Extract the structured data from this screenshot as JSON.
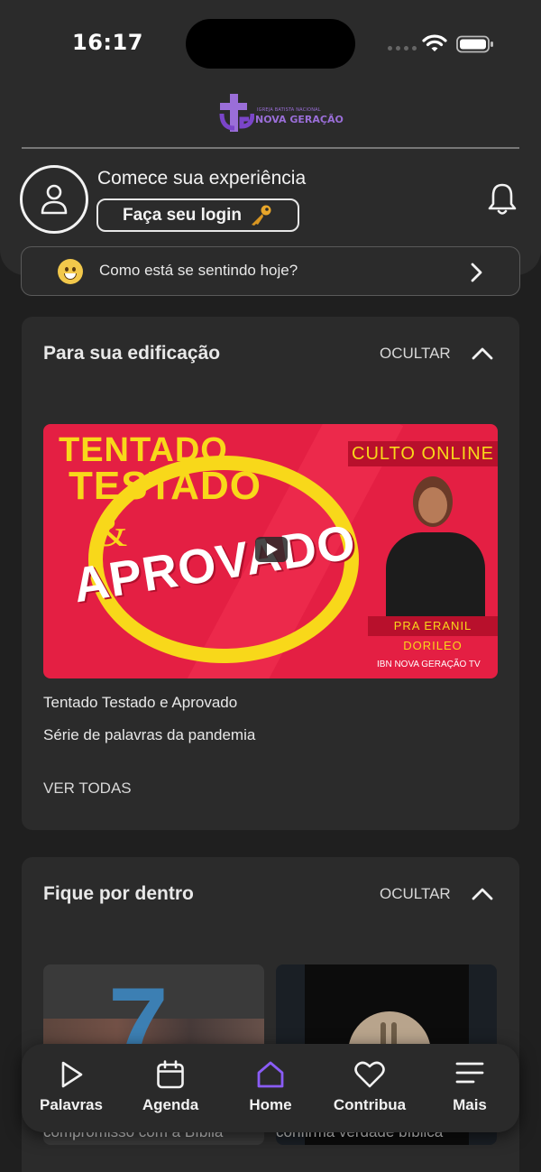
{
  "status": {
    "time": "16:17"
  },
  "logo": {
    "small_text": "IGREJA BATISTA NACIONAL",
    "big_text": "NOVA GERAÇÃO"
  },
  "header": {
    "welcome_title": "Comece sua experiência",
    "login_label": "Faça seu login"
  },
  "feeling": {
    "prompt": "Como está se sentindo hoje?"
  },
  "section_edification": {
    "title": "Para sua edificação",
    "hide_label": "OCULTAR",
    "thumbnail": {
      "line1": "TENTADO",
      "line2": "TESTADO",
      "amp": "&",
      "line3": "APROVADO",
      "culto": "CULTO ONLINE",
      "speaker": "PRA ERANIL DORILEO",
      "channel": "IBN NOVA GERAÇÃO TV"
    },
    "post_title": "Tentado Testado e Aprovado",
    "post_subtitle": "Série de palavras da pandemia",
    "see_all": "VER TODAS"
  },
  "section_news": {
    "title": "Fique por dentro",
    "hide_label": "OCULTAR",
    "items": [
      {
        "number": "7",
        "caption": "compromisso com a Bíblia"
      },
      {
        "caption": "confirma verdade bíblica"
      }
    ]
  },
  "tabs": [
    {
      "label": "Palavras",
      "icon": "play-icon"
    },
    {
      "label": "Agenda",
      "icon": "calendar-icon"
    },
    {
      "label": "Home",
      "icon": "home-icon",
      "active": true
    },
    {
      "label": "Contribua",
      "icon": "heart-icon"
    },
    {
      "label": "Mais",
      "icon": "menu-icon"
    }
  ],
  "colors": {
    "accent": "#8a5cf6",
    "background": "#1f1f1f",
    "card": "#2b2b2b",
    "logo": "#9a6ed8"
  }
}
